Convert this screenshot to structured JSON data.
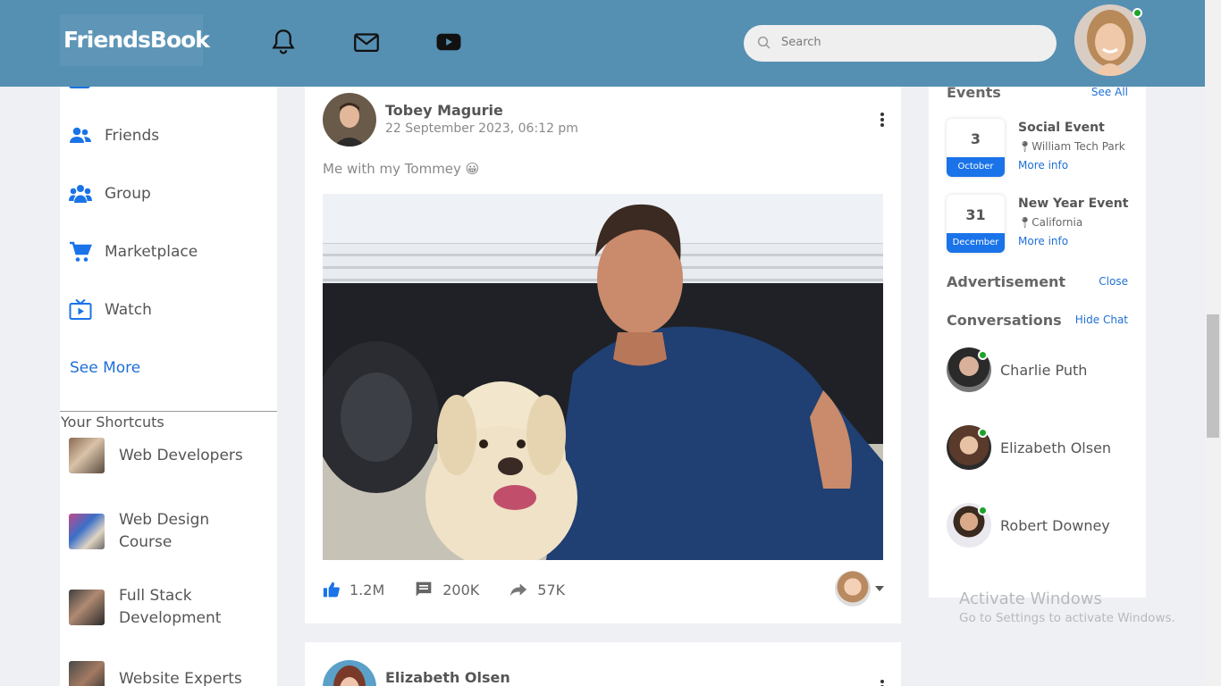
{
  "app": {
    "logo": "FriendsBook"
  },
  "header": {
    "search_placeholder": "Search",
    "icons": [
      "bell-icon",
      "mail-icon",
      "youtube-icon"
    ]
  },
  "sidebar": {
    "items": [
      {
        "label": "Friends",
        "icon": "friends-icon"
      },
      {
        "label": "Group",
        "icon": "group-icon"
      },
      {
        "label": "Marketplace",
        "icon": "cart-icon"
      },
      {
        "label": "Watch",
        "icon": "watch-icon"
      }
    ],
    "see_more": "See More",
    "shortcuts_title": "Your Shortcuts",
    "shortcuts": [
      {
        "label": "Web Developers"
      },
      {
        "label": "Web Design Course"
      },
      {
        "label": "Full Stack Development"
      },
      {
        "label": "Website Experts"
      }
    ]
  },
  "posts": [
    {
      "author": "Tobey Magurie",
      "date": "22 September 2023, 06:12 pm",
      "caption": "Me with my Tommey 😀",
      "likes": "1.2M",
      "comments": "200K",
      "shares": "57K"
    },
    {
      "author": "Elizabeth Olsen"
    }
  ],
  "events": {
    "title": "Events",
    "see_all": "See All",
    "items": [
      {
        "day": "3",
        "month": "October",
        "name": "Social Event",
        "location": "William Tech Park",
        "more": "More info"
      },
      {
        "day": "31",
        "month": "December",
        "name": "New Year Event",
        "location": "California",
        "more": "More info"
      }
    ]
  },
  "advertisement": {
    "title": "Advertisement",
    "close": "Close"
  },
  "conversations": {
    "title": "Conversations",
    "hide": "Hide Chat",
    "people": [
      {
        "name": "Charlie Puth"
      },
      {
        "name": "Elizabeth Olsen"
      },
      {
        "name": "Robert Downey"
      }
    ]
  },
  "watermark": {
    "line1": "Activate Windows",
    "line2": "Go to Settings to activate Windows."
  },
  "colors": {
    "header": "#558fb2",
    "accent": "#1a73e8",
    "online": "#1aa52a"
  }
}
